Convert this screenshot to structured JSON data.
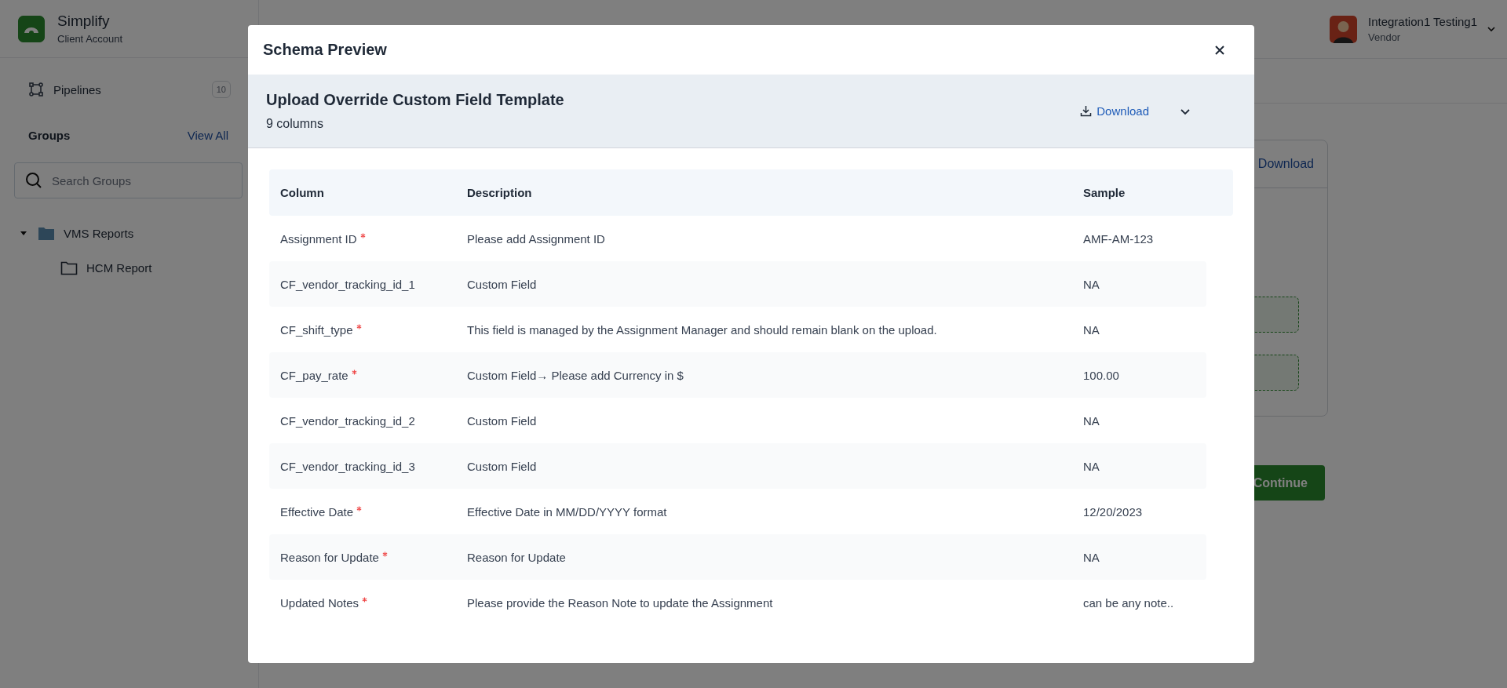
{
  "sidebar": {
    "brand": {
      "name": "Simplify",
      "subtitle": "Client Account"
    },
    "nav": [
      {
        "label": "Pipelines",
        "count": "10"
      }
    ],
    "groups": {
      "title": "Groups",
      "link": "View All"
    },
    "search": {
      "placeholder": "Search Groups"
    },
    "tree": [
      {
        "label": "VMS Reports",
        "expanded": true,
        "children": [
          {
            "label": "HCM Report"
          }
        ]
      }
    ]
  },
  "header": {
    "user": {
      "name": "Integration1 Testing1",
      "role": "Vendor"
    }
  },
  "background": {
    "card_link": "Download",
    "continue_button": "Continue"
  },
  "modal": {
    "title": "Schema Preview",
    "template": {
      "name": "Upload Override Custom Field Template",
      "count": "9 columns",
      "download": "Download"
    },
    "table": {
      "columns": [
        "Column",
        "Description",
        "Sample"
      ],
      "rows": [
        {
          "column": "Assignment ID",
          "required": true,
          "description": "Please add Assignment ID",
          "sample": "AMF-AM-123"
        },
        {
          "column": "CF_vendor_tracking_id_1",
          "required": false,
          "description": "Custom Field",
          "sample": "NA"
        },
        {
          "column": "CF_shift_type",
          "required": true,
          "description": "This field is managed by the Assignment Manager and should remain blank on the upload.",
          "sample": "NA"
        },
        {
          "column": "CF_pay_rate",
          "required": true,
          "description": "Custom Field→ Please add Currency in $",
          "sample": "100.00"
        },
        {
          "column": "CF_vendor_tracking_id_2",
          "required": false,
          "description": "Custom Field",
          "sample": "NA"
        },
        {
          "column": "CF_vendor_tracking_id_3",
          "required": false,
          "description": "Custom Field",
          "sample": "NA"
        },
        {
          "column": "Effective Date",
          "required": true,
          "description": "Effective Date in MM/DD/YYYY format",
          "sample": "12/20/2023"
        },
        {
          "column": "Reason for Update",
          "required": true,
          "description": "Reason for Update",
          "sample": "NA"
        },
        {
          "column": "Updated Notes",
          "required": true,
          "description": "Please provide the Reason Note to update the Assignment",
          "sample": "can be any note.."
        }
      ]
    }
  }
}
